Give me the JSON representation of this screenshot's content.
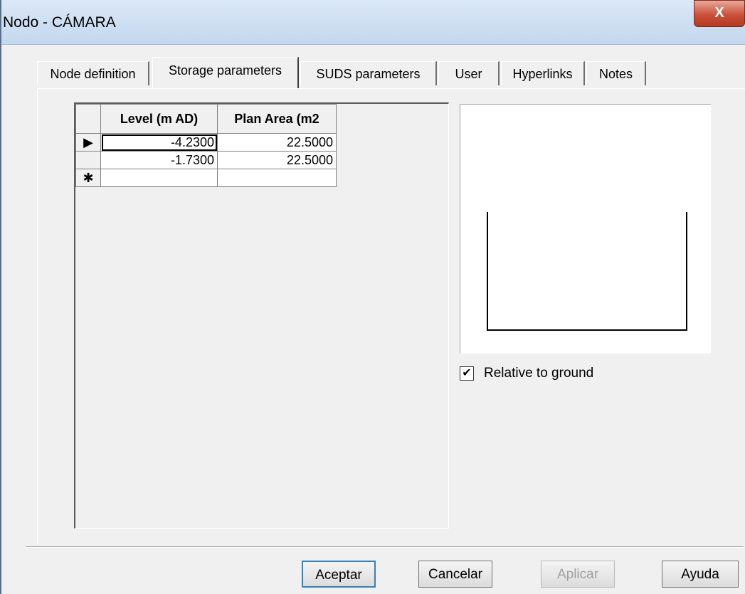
{
  "window": {
    "title": "Nodo - CÁMARA",
    "close_glyph": "X"
  },
  "tabs": [
    {
      "label": "Node definition",
      "active": false
    },
    {
      "label": "Storage parameters",
      "active": true
    },
    {
      "label": "SUDS parameters",
      "active": false
    },
    {
      "label": "User",
      "active": false
    },
    {
      "label": "Hyperlinks",
      "active": false
    },
    {
      "label": "Notes",
      "active": false
    }
  ],
  "grid": {
    "columns": [
      "Level (m AD)",
      "Plan Area (m2"
    ],
    "rows": [
      {
        "indicator": "▶",
        "level": "-4.2300",
        "area": "22.5000"
      },
      {
        "indicator": "",
        "level": "-1.7300",
        "area": "22.5000"
      },
      {
        "indicator": "✱",
        "level": "",
        "area": ""
      }
    ]
  },
  "relative_to_ground": {
    "label": "Relative to ground",
    "checked": true,
    "mark": "✔"
  },
  "buttons": {
    "accept": "Aceptar",
    "cancel": "Cancelar",
    "apply": "Aplicar",
    "help": "Ayuda"
  },
  "icons": {
    "close": "close-icon",
    "current_row": "current-row-icon",
    "new_row": "new-row-icon"
  }
}
